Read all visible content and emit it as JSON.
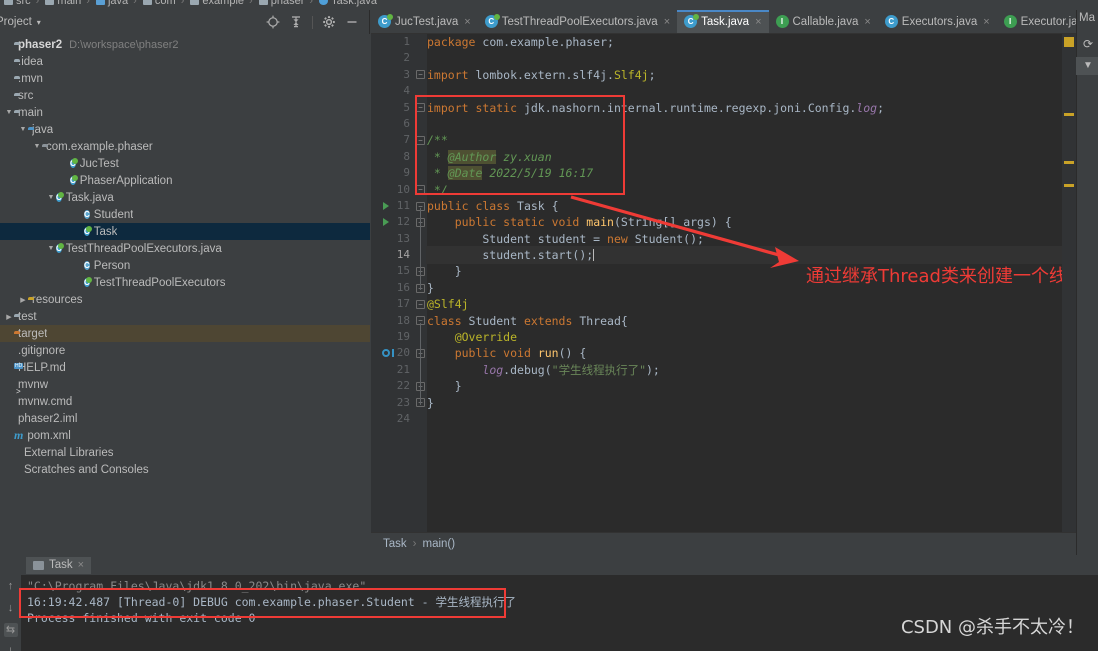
{
  "navstrip": {
    "crumbs": [
      "src",
      "main",
      "java",
      "com",
      "example",
      "phaser",
      "Task.java"
    ]
  },
  "project_panel": {
    "title": "Project",
    "caret": "▾",
    "actions": [
      {
        "name": "locate-icon",
        "glyph": "⊕"
      },
      {
        "name": "collapse-all-icon",
        "glyph": "≡"
      },
      {
        "name": "settings-gear-icon",
        "glyph": "⚙"
      },
      {
        "name": "hide-icon",
        "glyph": "—"
      }
    ],
    "tree": [
      {
        "label": "phaser2",
        "path": "D:\\workspace\\phaser2",
        "indent": 0,
        "arrow": "",
        "icon": "folder-root",
        "bold": true
      },
      {
        "label": ".idea",
        "path": "",
        "indent": 0,
        "arrow": "",
        "icon": "folder-gray"
      },
      {
        "label": ".mvn",
        "path": "",
        "indent": 0,
        "arrow": "",
        "icon": "folder-gray"
      },
      {
        "label": "src",
        "path": "",
        "indent": 0,
        "arrow": "",
        "icon": "folder-gray"
      },
      {
        "label": "main",
        "path": "",
        "indent": 0,
        "arrow": "▼",
        "icon": "folder-gray"
      },
      {
        "label": "java",
        "path": "",
        "indent": 1,
        "arrow": "▼",
        "icon": "folder-blue"
      },
      {
        "label": "com.example.phaser",
        "path": "",
        "indent": 2,
        "arrow": "▼",
        "icon": "folder-package"
      },
      {
        "label": "JucTest",
        "path": "",
        "indent": 4,
        "arrow": "",
        "icon": "class-runnable"
      },
      {
        "label": "PhaserApplication",
        "path": "",
        "indent": 4,
        "arrow": "",
        "icon": "class-spring"
      },
      {
        "label": "Task.java",
        "path": "",
        "indent": 3,
        "arrow": "▼",
        "icon": "class-runnable"
      },
      {
        "label": "Student",
        "path": "",
        "indent": 5,
        "arrow": "",
        "icon": "class-plain"
      },
      {
        "label": "Task",
        "path": "",
        "indent": 5,
        "arrow": "",
        "icon": "class-runnable",
        "selected": true
      },
      {
        "label": "TestThreadPoolExecutors.java",
        "path": "",
        "indent": 3,
        "arrow": "▼",
        "icon": "class-runnable"
      },
      {
        "label": "Person",
        "path": "",
        "indent": 5,
        "arrow": "",
        "icon": "class-plain"
      },
      {
        "label": "TestThreadPoolExecutors",
        "path": "",
        "indent": 5,
        "arrow": "",
        "icon": "class-runnable"
      },
      {
        "label": "resources",
        "path": "",
        "indent": 1,
        "arrow": "▶",
        "icon": "folder-resources"
      },
      {
        "label": "test",
        "path": "",
        "indent": 0,
        "arrow": "▶",
        "icon": "folder-gray"
      },
      {
        "label": "target",
        "path": "",
        "indent": 0,
        "arrow": "",
        "icon": "folder-orange",
        "highlighted": true
      },
      {
        "label": ".gitignore",
        "path": "",
        "indent": 0,
        "arrow": "",
        "icon": "file-git"
      },
      {
        "label": "HELP.md",
        "path": "",
        "indent": 0,
        "arrow": "",
        "icon": "file-md"
      },
      {
        "label": "mvnw",
        "path": "",
        "indent": 0,
        "arrow": "",
        "icon": "file-sh"
      },
      {
        "label": "mvnw.cmd",
        "path": "",
        "indent": 0,
        "arrow": "",
        "icon": "file-generic"
      },
      {
        "label": "phaser2.iml",
        "path": "",
        "indent": 0,
        "arrow": "",
        "icon": "file-generic"
      },
      {
        "label": "pom.xml",
        "path": "",
        "indent": 0,
        "arrow": "",
        "icon": "file-maven"
      },
      {
        "label": "External Libraries",
        "path": "",
        "indent": -1,
        "arrow": "",
        "icon": "none"
      },
      {
        "label": "Scratches and Consoles",
        "path": "",
        "indent": -1,
        "arrow": "",
        "icon": "none"
      }
    ]
  },
  "editor": {
    "tabs": [
      {
        "label": "JucTest.java",
        "icon": "class-runnable",
        "active": false
      },
      {
        "label": "TestThreadPoolExecutors.java",
        "icon": "class-runnable",
        "active": false
      },
      {
        "label": "Task.java",
        "icon": "class-runnable",
        "active": true
      },
      {
        "label": "Callable.java",
        "icon": "interface-locked",
        "active": false
      },
      {
        "label": "Executors.java",
        "icon": "class-locked",
        "active": false
      },
      {
        "label": "Executor.java",
        "icon": "interface-locked",
        "active": false
      }
    ],
    "tab_close_glyph": "×",
    "tab_overflow_glyph": "▾≡",
    "tab_overflow_count": "1",
    "breadcrumb": {
      "class": "Task",
      "separator": "›",
      "method": "main()"
    },
    "lines": [
      {
        "n": 1,
        "text": "package com.example.phaser;"
      },
      {
        "n": 2,
        "text": ""
      },
      {
        "n": 3,
        "text": "import lombok.extern.slf4j.Slf4j;"
      },
      {
        "n": 4,
        "text": ""
      },
      {
        "n": 5,
        "text": "import static jdk.nashorn.internal.runtime.regexp.joni.Config.log;"
      },
      {
        "n": 6,
        "text": ""
      },
      {
        "n": 7,
        "text": "/**"
      },
      {
        "n": 8,
        "text": " * @Author zy.xuan"
      },
      {
        "n": 9,
        "text": " * @Date 2022/5/19 16:17"
      },
      {
        "n": 10,
        "text": " */"
      },
      {
        "n": 11,
        "text": "public class Task {"
      },
      {
        "n": 12,
        "text": "    public static void main(String[] args) {"
      },
      {
        "n": 13,
        "text": "        Student student = new Student();"
      },
      {
        "n": 14,
        "text": "        student.start();"
      },
      {
        "n": 15,
        "text": "    }"
      },
      {
        "n": 16,
        "text": "}"
      },
      {
        "n": 17,
        "text": "@Slf4j"
      },
      {
        "n": 18,
        "text": "class Student extends Thread{"
      },
      {
        "n": 19,
        "text": "    @Override"
      },
      {
        "n": 20,
        "text": "    public void run() {"
      },
      {
        "n": 21,
        "text": "        log.debug(\"学生线程执行了\");"
      },
      {
        "n": 22,
        "text": "    }"
      },
      {
        "n": 23,
        "text": "}"
      },
      {
        "n": 24,
        "text": ""
      }
    ],
    "current_line": 14,
    "annotation": {
      "text": "通过继承Thread类来创建一个线程",
      "color": "#ef3b36"
    }
  },
  "right_sidebar": {
    "label": "Ma",
    "refresh_glyph": "⟳",
    "filter_glyph": "▼"
  },
  "run_panel": {
    "tab": {
      "label": "Task",
      "close": "×",
      "icon": "run-config-icon"
    },
    "side_icons": [
      {
        "name": "scroll-up-icon",
        "glyph": "↑"
      },
      {
        "name": "scroll-down-icon",
        "glyph": "↓"
      },
      {
        "name": "soft-wrap-icon",
        "glyph": "⇆",
        "boxed": true
      },
      {
        "name": "scroll-to-end-icon",
        "glyph": "⤓"
      }
    ],
    "console_lines": [
      {
        "text": "\"C:\\Program Files\\Java\\jdk1.8.0_202\\bin\\java.exe\" ...",
        "dim": true
      },
      {
        "text": "16:19:42.487 [Thread-0] DEBUG com.example.phaser.Student - 学生线程执行了",
        "dim": false
      },
      {
        "text": "",
        "dim": false
      },
      {
        "text": "Process finished with exit code 0",
        "dim": false
      }
    ]
  },
  "watermark": {
    "text": "CSDN @杀手不太冷！"
  },
  "colors": {
    "panel_bg": "#3c3f41",
    "editor_bg": "#2b2b2b",
    "gutter_bg": "#313335",
    "selection": "#0d293e",
    "accent_red": "#ef3b36",
    "keyword_orange": "#cc7832",
    "string_green": "#6a8759",
    "annotation_yellow": "#bbb529",
    "comment_green": "#629755",
    "target_highlight": "#4e4633"
  }
}
